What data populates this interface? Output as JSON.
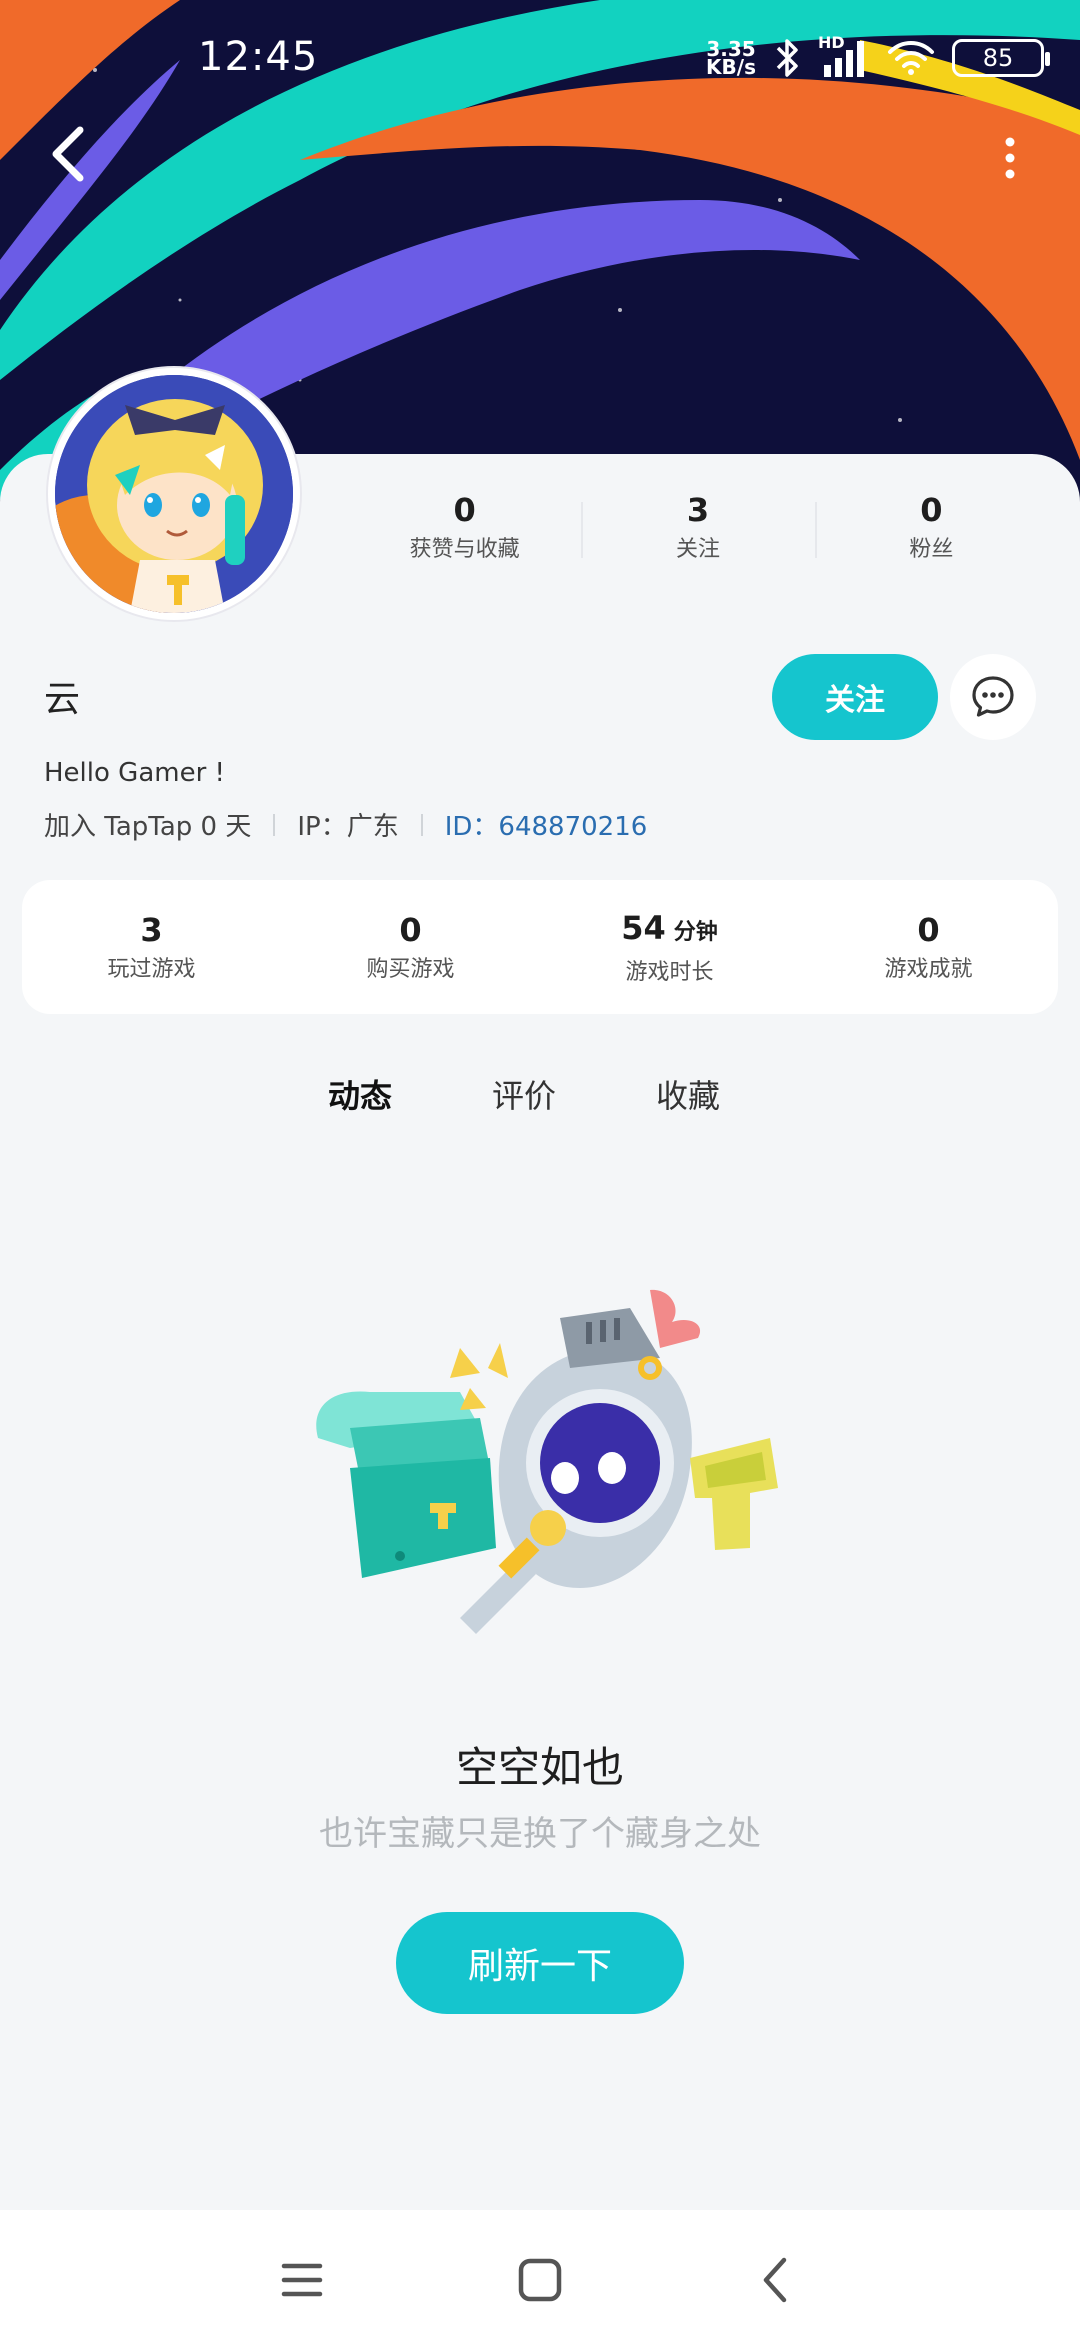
{
  "status_bar": {
    "time": "12:45",
    "net_speed_value": "3.35",
    "net_speed_unit": "KB/s",
    "network_label": "HD",
    "battery": "85"
  },
  "header": {
    "back_icon": "chevron-left-icon",
    "more_icon": "more-vertical-icon"
  },
  "profile": {
    "username": "云",
    "bio": "Hello Gamer !",
    "joined": "加入 TapTap 0 天",
    "ip": "IP：广东",
    "id": "ID：648870216",
    "follow_label": "关注",
    "message_icon": "chat-bubble-icon"
  },
  "top_stats": [
    {
      "value": "0",
      "label": "获赞与收藏"
    },
    {
      "value": "3",
      "label": "关注"
    },
    {
      "value": "0",
      "label": "粉丝"
    }
  ],
  "game_stats": [
    {
      "value": "3",
      "unit": "",
      "label": "玩过游戏"
    },
    {
      "value": "0",
      "unit": "",
      "label": "购买游戏"
    },
    {
      "value": "54",
      "unit": "分钟",
      "label": "游戏时长"
    },
    {
      "value": "0",
      "unit": "",
      "label": "游戏成就"
    }
  ],
  "tabs": [
    {
      "label": "动态",
      "active": true
    },
    {
      "label": "评价",
      "active": false
    },
    {
      "label": "收藏",
      "active": false
    }
  ],
  "empty_state": {
    "title": "空空如也",
    "subtitle": "也许宝藏只是换了个藏身之处",
    "button": "刷新一下"
  },
  "colors": {
    "accent": "#15c5ce",
    "id_link": "#2a6db0",
    "banner_bg": "#0e0f3a"
  }
}
